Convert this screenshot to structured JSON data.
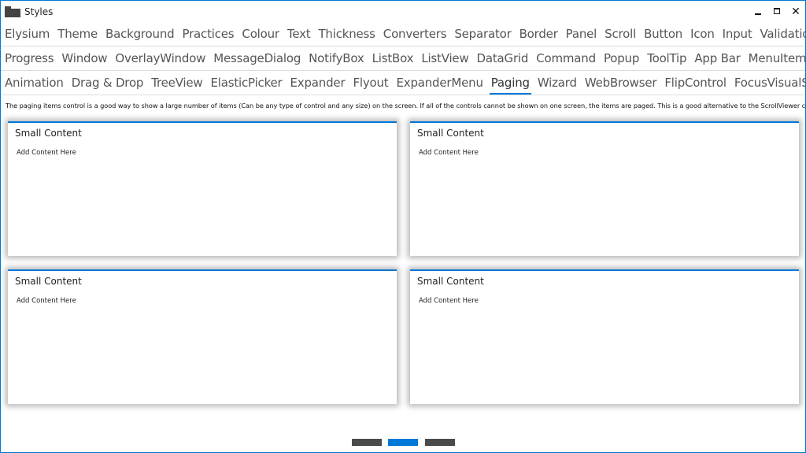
{
  "window": {
    "title": "Styles",
    "minimize_glyph": "",
    "maximize_glyph": "",
    "close_glyph": "✕"
  },
  "nav": {
    "row1": [
      "Elysium",
      "Theme",
      "Background",
      "Practices",
      "Colour",
      "Text",
      "Thickness",
      "Converters",
      "Separator",
      "Border",
      "Panel",
      "Scroll",
      "Button",
      "Icon",
      "Input",
      "Validation"
    ],
    "row2": [
      "Progress",
      "Window",
      "OverlayWindow",
      "MessageDialog",
      "NotifyBox",
      "ListBox",
      "ListView",
      "DataGrid",
      "Command",
      "Popup",
      "ToolTip",
      "App Bar",
      "MenuItem"
    ],
    "row3": [
      "Animation",
      "Drag & Drop",
      "TreeView",
      "ElasticPicker",
      "Expander",
      "Flyout",
      "ExpanderMenu",
      "Paging",
      "Wizard",
      "WebBrowser",
      "FlipControl",
      "FocusVisualStyle"
    ],
    "active": "Paging"
  },
  "description": "The paging items control is a good way to show a large number of items (Can be any type of control and any size) on the screen. If all of the controls cannot be shown on one screen, the items are paged. This is a good alternative to the ScrollViewer control.",
  "cards": [
    {
      "title": "Small Content",
      "body": "Add Content Here"
    },
    {
      "title": "Small Content",
      "body": "Add Content Here"
    },
    {
      "title": "Small Content",
      "body": "Add Content Here"
    },
    {
      "title": "Small Content",
      "body": "Add Content Here"
    }
  ],
  "pager": {
    "page_count": 3,
    "current_page": 2
  },
  "colors": {
    "accent": "#0078d7",
    "pager_inactive": "#4a4a4a"
  }
}
